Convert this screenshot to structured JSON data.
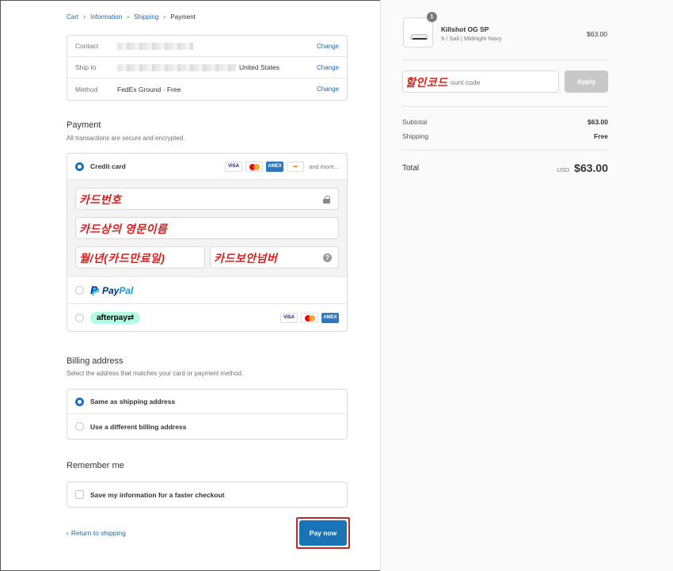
{
  "breadcrumb": {
    "cart": "Cart",
    "information": "Information",
    "shipping": "Shipping",
    "payment": "Payment"
  },
  "review": {
    "contact_label": "Contact",
    "ship_to_label": "Ship to",
    "ship_to_country": "United States",
    "method_label": "Method",
    "method_value": "FedEx Ground · Free",
    "change": "Change"
  },
  "payment": {
    "title": "Payment",
    "subtitle": "All transactions are secure and encrypted.",
    "credit_card_label": "Credit card",
    "card_icons": [
      "VISA",
      "mastercard",
      "AMEX",
      "discover"
    ],
    "and_more": "and more...",
    "card_number_annotation": "카드번호",
    "name_on_card_annotation": "카드상의 영문이름",
    "expiry_annotation": "월/년(카드만료일)",
    "security_code_annotation": "카드보안넘버",
    "paypal_label_1": "Pay",
    "paypal_label_2": "Pal",
    "afterpay_label": "afterpay⇄"
  },
  "billing": {
    "title": "Billing address",
    "subtitle": "Select the address that matches your card or payment method.",
    "same_label": "Same as shipping address",
    "different_label": "Use a different billing address"
  },
  "remember": {
    "title": "Remember me",
    "save_label": "Save my information for a faster checkout"
  },
  "footer": {
    "return_label": "Return to shipping",
    "pay_label": "Pay now"
  },
  "summary": {
    "qty": "1",
    "product_name": "Killshot OG SP",
    "product_variant": "9 / Sail | Midnight Navy",
    "product_price": "$63.00",
    "discount_annotation": "할인코드",
    "discount_placeholder": "ount code",
    "apply_label": "Apply",
    "subtotal_label": "Subtotal",
    "subtotal_value": "$63.00",
    "shipping_label": "Shipping",
    "shipping_value": "Free",
    "total_label": "Total",
    "currency": "USD",
    "total_value": "$63.00"
  },
  "colors": {
    "accent": "#1a73b5",
    "annotation": "#e11b1b",
    "highlight_border": "#c0272d"
  }
}
